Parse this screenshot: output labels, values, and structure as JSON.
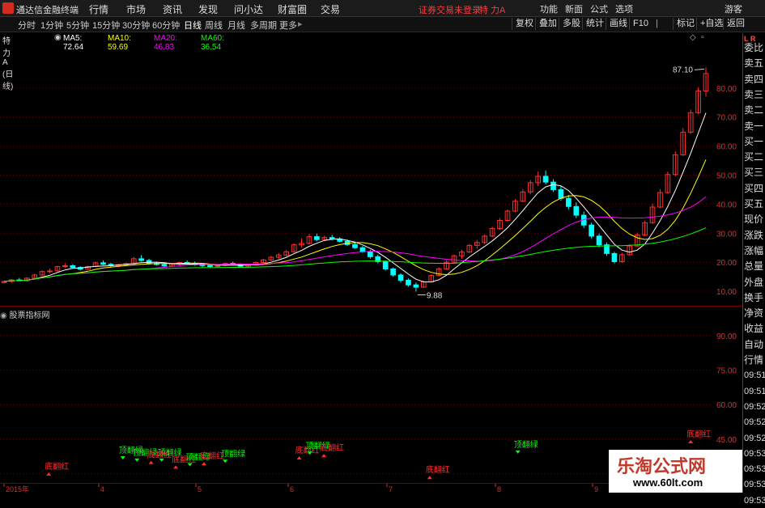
{
  "menubar": {
    "app_title": "通达信金融终端",
    "menus": [
      "行情",
      "市场",
      "资讯",
      "发现",
      "问小达",
      "财富圈",
      "交易"
    ],
    "warning": "证券交易未登录",
    "stock_name": "特 力A",
    "right_menus": [
      "功能",
      "新面",
      "公式",
      "选项"
    ],
    "user": "游客"
  },
  "toolbar": {
    "periods": [
      "分时",
      "1分钟",
      "5分钟",
      "15分钟",
      "30分钟",
      "60分钟",
      "日线",
      "周线",
      "月线",
      "多周期",
      "更多"
    ],
    "active_period": "日线",
    "right_buttons": [
      "复权",
      "叠加",
      "多股",
      "统计",
      "画线",
      "F10",
      "标记",
      "+自选",
      "返回"
    ]
  },
  "infobar": {
    "title": "特 力A (日线)",
    "ma": [
      {
        "label": "MA5: 72.64",
        "color": "#ffffff"
      },
      {
        "label": "MA10: 59.69",
        "color": "#ffff00"
      },
      {
        "label": "MA20: 46.83",
        "color": "#ff00ff"
      },
      {
        "label": "MA60: 36.54",
        "color": "#00ff00"
      }
    ]
  },
  "right_panel": {
    "top": "L R",
    "items": [
      "委比",
      "卖五",
      "卖四",
      "卖三",
      "卖二",
      "卖一",
      "买一",
      "买二",
      "买三",
      "买四",
      "买五",
      "现价",
      "涨跌",
      "涨幅",
      "总量",
      "外盘",
      "换手",
      "净资",
      "收益",
      "自动",
      "行情",
      "09:51",
      "09:51",
      "09:52",
      "09:52",
      "09:52",
      "09:53",
      "09:53",
      "09:53",
      "09:53"
    ]
  },
  "chart_data": [
    {
      "type": "candlestick",
      "title": "特 力A (日线)",
      "y_ticks": [
        10.0,
        20.0,
        30.0,
        40.0,
        50.0,
        60.0,
        70.0,
        80.0
      ],
      "ylim": [
        5,
        95
      ],
      "x_labels": [
        "2015年",
        "4",
        "5",
        "6",
        "7",
        "8",
        "9"
      ],
      "annotations": [
        "87.10",
        "9.88"
      ],
      "series": [
        {
          "name": "MA5: 72.64",
          "color": "#ffffff"
        },
        {
          "name": "MA10: 59.69",
          "color": "#ffff00"
        },
        {
          "name": "MA20: 46.83",
          "color": "#ff00ff"
        },
        {
          "name": "MA60: 36.54",
          "color": "#00ff00"
        }
      ],
      "candles": [
        [
          13.0,
          13.6,
          12.6,
          13.4
        ],
        [
          13.4,
          14.2,
          13.0,
          13.9
        ],
        [
          13.9,
          14.6,
          13.5,
          13.6
        ],
        [
          13.6,
          14.8,
          13.4,
          14.5
        ],
        [
          14.5,
          16.0,
          14.2,
          15.6
        ],
        [
          15.6,
          17.2,
          15.3,
          16.8
        ],
        [
          16.8,
          17.8,
          16.2,
          17.0
        ],
        [
          17.0,
          18.8,
          16.8,
          18.5
        ],
        [
          18.5,
          19.6,
          18.0,
          18.8
        ],
        [
          18.8,
          19.3,
          17.8,
          18.2
        ],
        [
          18.2,
          18.6,
          17.2,
          17.6
        ],
        [
          17.6,
          18.8,
          17.4,
          18.5
        ],
        [
          18.5,
          20.2,
          18.3,
          19.8
        ],
        [
          19.8,
          20.6,
          19.0,
          19.3
        ],
        [
          19.3,
          19.8,
          18.3,
          18.8
        ],
        [
          18.8,
          19.4,
          18.2,
          19.1
        ],
        [
          19.1,
          19.9,
          18.7,
          19.5
        ],
        [
          19.5,
          21.8,
          19.2,
          21.2
        ],
        [
          21.2,
          22.4,
          20.2,
          20.6
        ],
        [
          20.6,
          21.2,
          19.2,
          19.6
        ],
        [
          19.6,
          20.2,
          18.8,
          19.2
        ],
        [
          19.2,
          19.8,
          18.4,
          18.7
        ],
        [
          18.7,
          19.7,
          18.5,
          19.4
        ],
        [
          19.4,
          20.2,
          18.9,
          19.9
        ],
        [
          19.9,
          20.6,
          19.3,
          19.6
        ],
        [
          19.6,
          20.2,
          18.8,
          19.1
        ],
        [
          19.1,
          19.6,
          18.4,
          18.9
        ],
        [
          18.9,
          19.4,
          18.2,
          18.5
        ],
        [
          18.5,
          19.2,
          18.1,
          18.9
        ],
        [
          18.9,
          19.9,
          18.6,
          19.6
        ],
        [
          19.6,
          20.2,
          18.9,
          19.2
        ],
        [
          19.2,
          19.6,
          18.3,
          18.6
        ],
        [
          18.6,
          19.3,
          18.2,
          19.0
        ],
        [
          19.0,
          20.2,
          18.8,
          19.9
        ],
        [
          19.9,
          21.2,
          19.6,
          20.8
        ],
        [
          20.8,
          22.2,
          20.4,
          21.7
        ],
        [
          21.7,
          23.2,
          21.2,
          22.5
        ],
        [
          22.5,
          24.2,
          22.0,
          23.6
        ],
        [
          23.6,
          26.5,
          23.2,
          26.0
        ],
        [
          26.0,
          28.2,
          25.0,
          26.5
        ],
        [
          26.5,
          29.8,
          26.2,
          28.8
        ],
        [
          28.8,
          29.9,
          27.2,
          27.8
        ],
        [
          27.8,
          29.2,
          27.2,
          28.5
        ],
        [
          28.5,
          29.4,
          27.6,
          28.0
        ],
        [
          28.0,
          28.6,
          26.8,
          27.2
        ],
        [
          27.2,
          27.9,
          25.7,
          26.1
        ],
        [
          26.1,
          26.9,
          24.6,
          25.0
        ],
        [
          25.0,
          25.6,
          23.2,
          23.6
        ],
        [
          23.6,
          24.3,
          21.2,
          21.9
        ],
        [
          21.9,
          22.6,
          19.6,
          20.2
        ],
        [
          20.2,
          20.6,
          17.2,
          17.7
        ],
        [
          17.7,
          18.2,
          15.0,
          15.6
        ],
        [
          15.6,
          16.2,
          13.0,
          13.8
        ],
        [
          13.8,
          14.4,
          11.6,
          12.2
        ],
        [
          12.2,
          13.0,
          9.88,
          11.4
        ],
        [
          11.4,
          13.6,
          11.2,
          13.2
        ],
        [
          13.2,
          15.8,
          13.0,
          15.4
        ],
        [
          15.4,
          18.2,
          15.1,
          17.7
        ],
        [
          17.7,
          20.6,
          17.4,
          20.0
        ],
        [
          20.0,
          22.7,
          19.5,
          22.2
        ],
        [
          22.2,
          24.3,
          21.2,
          23.5
        ],
        [
          23.5,
          26.2,
          23.2,
          25.8
        ],
        [
          25.8,
          27.7,
          24.6,
          26.8
        ],
        [
          26.8,
          29.6,
          26.2,
          29.0
        ],
        [
          29.0,
          32.2,
          28.6,
          31.6
        ],
        [
          31.6,
          35.2,
          31.2,
          34.4
        ],
        [
          34.4,
          38.2,
          34.0,
          37.6
        ],
        [
          37.6,
          41.8,
          37.2,
          41.0
        ],
        [
          41.0,
          45.2,
          40.6,
          44.2
        ],
        [
          44.2,
          48.3,
          43.4,
          47.4
        ],
        [
          47.4,
          51.2,
          46.2,
          49.6
        ],
        [
          49.6,
          51.6,
          46.8,
          47.6
        ],
        [
          47.6,
          48.6,
          44.2,
          45.0
        ],
        [
          45.0,
          46.2,
          41.2,
          42.0
        ],
        [
          42.0,
          43.2,
          38.2,
          39.2
        ],
        [
          39.2,
          40.6,
          35.2,
          36.2
        ],
        [
          36.2,
          37.4,
          31.8,
          32.8
        ],
        [
          32.8,
          33.6,
          28.2,
          29.0
        ],
        [
          29.0,
          29.9,
          25.2,
          26.0
        ],
        [
          26.0,
          26.8,
          22.2,
          23.0
        ],
        [
          23.0,
          23.6,
          19.6,
          20.2
        ],
        [
          20.2,
          23.2,
          19.8,
          22.6
        ],
        [
          22.6,
          26.2,
          22.2,
          25.6
        ],
        [
          25.6,
          30.2,
          25.2,
          29.4
        ],
        [
          29.4,
          34.2,
          29.0,
          33.6
        ],
        [
          33.6,
          40.2,
          33.2,
          39.0
        ],
        [
          39.0,
          45.2,
          38.6,
          44.0
        ],
        [
          44.0,
          51.2,
          43.6,
          50.2
        ],
        [
          50.2,
          58.2,
          49.6,
          57.0
        ],
        [
          57.0,
          66.2,
          56.6,
          64.8
        ],
        [
          64.8,
          72.6,
          64.2,
          71.5
        ],
        [
          71.5,
          80.2,
          71.0,
          79.0
        ],
        [
          79.0,
          87.1,
          77.0,
          85.0
        ]
      ]
    },
    {
      "type": "indicator",
      "title": "股票指标网",
      "y_ticks": [
        30.0,
        45.0,
        60.0,
        75.0,
        90.0
      ],
      "ylim": [
        26,
        98
      ],
      "signals": [
        {
          "label": "底翻红",
          "i": 12,
          "v": 32.0,
          "color": "#ff3030"
        },
        {
          "label": "顶翻绿",
          "i": 33,
          "v": 39.0,
          "color": "#00ff00"
        },
        {
          "label": "顶翻绿",
          "i": 37,
          "v": 38.0,
          "color": "#00ff00"
        },
        {
          "label": "底翻红",
          "i": 41,
          "v": 37.0,
          "color": "#ff3030"
        },
        {
          "label": "顶翻绿",
          "i": 44,
          "v": 38.0,
          "color": "#00ff00"
        },
        {
          "label": "底翻红",
          "i": 48,
          "v": 35.0,
          "color": "#ff3030"
        },
        {
          "label": "顶翻绿",
          "i": 52,
          "v": 36.0,
          "color": "#00ff00"
        },
        {
          "label": "底翻红",
          "i": 56,
          "v": 36.5,
          "color": "#ff3030"
        },
        {
          "label": "顶翻绿",
          "i": 62,
          "v": 37.5,
          "color": "#00ff00"
        },
        {
          "label": "底翻红",
          "i": 83,
          "v": 39.0,
          "color": "#ff3030"
        },
        {
          "label": "顶翻绿",
          "i": 86,
          "v": 41.0,
          "color": "#00ff00"
        },
        {
          "label": "底翻红",
          "i": 90,
          "v": 40.0,
          "color": "#ff3030"
        },
        {
          "label": "底翻红",
          "i": 120,
          "v": 30.5,
          "color": "#ff3030"
        },
        {
          "label": "顶翻绿",
          "i": 145,
          "v": 41.5,
          "color": "#00ff00"
        },
        {
          "label": "底翻红",
          "i": 194,
          "v": 46.0,
          "color": "#ff3030"
        }
      ]
    }
  ],
  "watermark": {
    "title": "乐淘公式网",
    "url": "www.60lt.com"
  }
}
